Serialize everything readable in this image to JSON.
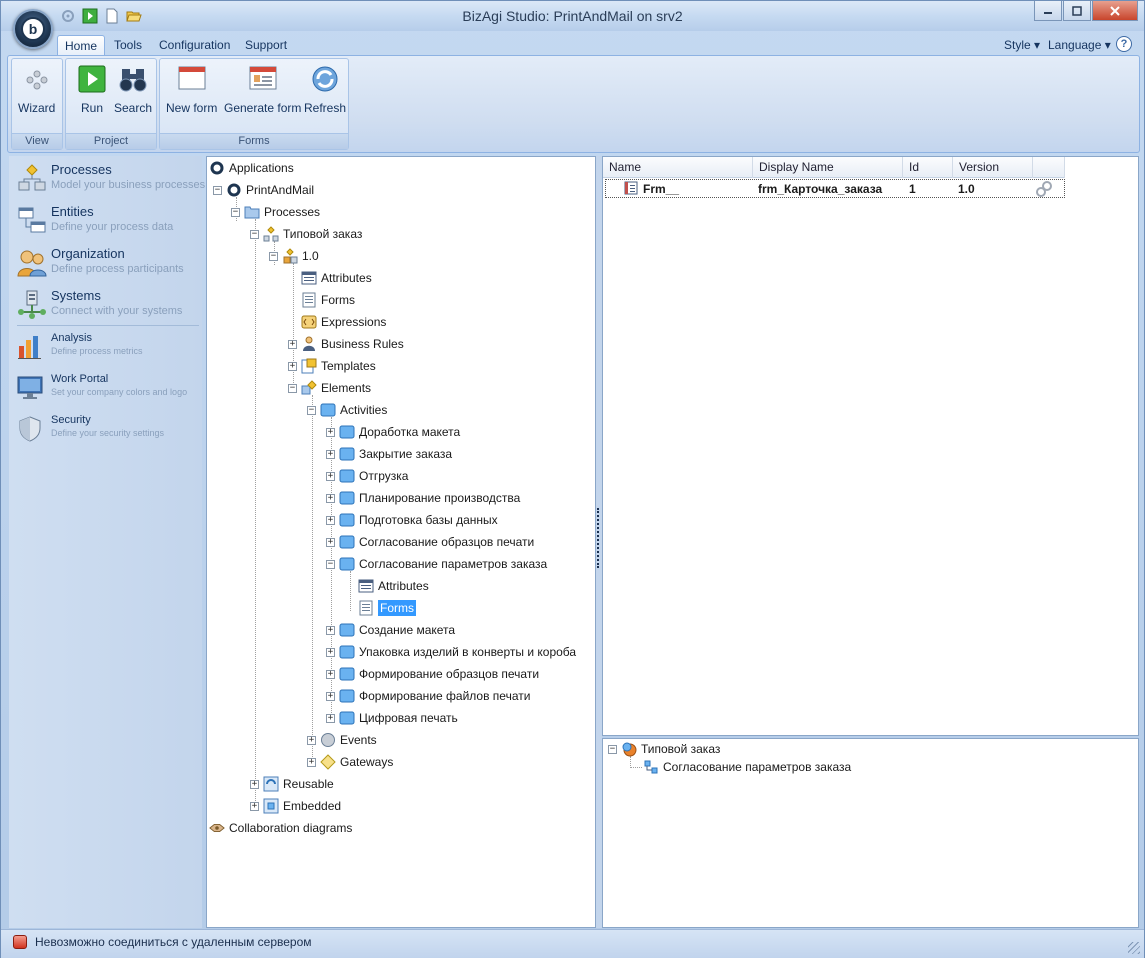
{
  "window": {
    "title": "BizAgi Studio: PrintAndMail on srv2",
    "controls": [
      "minimize-icon",
      "maximize-icon",
      "close-icon"
    ]
  },
  "quick_access": [
    "settings-icon",
    "run-icon",
    "new-icon",
    "open-icon"
  ],
  "ribbon": {
    "tabs": [
      "Home",
      "Tools",
      "Configuration",
      "Support"
    ],
    "active_tab": "Home",
    "right_menus": [
      "Style",
      "Language"
    ],
    "groups": [
      {
        "label": "View",
        "buttons": [
          {
            "label": "Wizard",
            "icon": "wizard-icon"
          }
        ]
      },
      {
        "label": "Project",
        "buttons": [
          {
            "label": "Run",
            "icon": "run-icon"
          },
          {
            "label": "Search",
            "icon": "binoculars-icon"
          }
        ]
      },
      {
        "label": "Forms",
        "buttons": [
          {
            "label": "New form",
            "icon": "new-form-icon"
          },
          {
            "label": "Generate form",
            "icon": "generate-form-icon"
          },
          {
            "label": "Refresh",
            "icon": "refresh-icon"
          }
        ]
      }
    ]
  },
  "leftnav": {
    "items": [
      {
        "title": "Processes",
        "subtitle": "Model your business processes",
        "icon": "processes-icon"
      },
      {
        "title": "Entities",
        "subtitle": "Define your process data",
        "icon": "entities-icon"
      },
      {
        "title": "Organization",
        "subtitle": "Define process participants",
        "icon": "organization-icon"
      },
      {
        "title": "Systems",
        "subtitle": "Connect with your systems",
        "icon": "systems-icon"
      },
      {
        "title": "Analysis",
        "subtitle": "Define process metrics",
        "icon": "analysis-icon"
      },
      {
        "title": "Work Portal",
        "subtitle": "Set your company colors and logo",
        "icon": "monitor-icon"
      },
      {
        "title": "Security",
        "subtitle": "Define your security settings",
        "icon": "shield-icon"
      }
    ]
  },
  "tree": {
    "nodes": [
      {
        "label": "Applications",
        "icon": "bizagi-icon",
        "exp": ""
      },
      {
        "label": "PrintAndMail",
        "icon": "bizagi-icon",
        "exp": "−"
      },
      {
        "label": "Processes",
        "icon": "folder-icon",
        "exp": "−"
      },
      {
        "label": "Типовой заказ",
        "icon": "process-icon",
        "exp": "−"
      },
      {
        "label": "1.0",
        "icon": "version-icon",
        "exp": "−"
      },
      {
        "label": "Attributes",
        "icon": "attributes-icon",
        "exp": ""
      },
      {
        "label": "Forms",
        "icon": "form-icon",
        "exp": ""
      },
      {
        "label": "Expressions",
        "icon": "expression-icon",
        "exp": ""
      },
      {
        "label": "Business Rules",
        "icon": "business-rules-icon",
        "exp": "+"
      },
      {
        "label": "Templates",
        "icon": "templates-icon",
        "exp": "+"
      },
      {
        "label": "Elements",
        "icon": "elements-icon",
        "exp": "−"
      },
      {
        "label": "Activities",
        "icon": "activity-icon",
        "exp": "−"
      },
      {
        "label": "Доработка макета",
        "icon": "activity-icon",
        "exp": "+"
      },
      {
        "label": "Закрытие заказа",
        "icon": "activity-icon",
        "exp": "+"
      },
      {
        "label": "Отгрузка",
        "icon": "activity-icon",
        "exp": "+"
      },
      {
        "label": "Планирование производства",
        "icon": "activity-icon",
        "exp": "+"
      },
      {
        "label": "Подготовка базы данных",
        "icon": "activity-icon",
        "exp": "+"
      },
      {
        "label": "Согласование образцов печати",
        "icon": "activity-icon",
        "exp": "+"
      },
      {
        "label": "Согласование параметров заказа",
        "icon": "activity-icon",
        "exp": "−"
      },
      {
        "label": "Attributes",
        "icon": "attributes-icon",
        "exp": ""
      },
      {
        "label": "Forms",
        "icon": "form-icon",
        "exp": "",
        "selected": true
      },
      {
        "label": "Создание макета",
        "icon": "activity-icon",
        "exp": "+"
      },
      {
        "label": "Упаковка изделий в конверты  и короба",
        "icon": "activity-icon",
        "exp": "+"
      },
      {
        "label": "Формирование образцов печати",
        "icon": "activity-icon",
        "exp": "+"
      },
      {
        "label": "Формирование файлов печати",
        "icon": "activity-icon",
        "exp": "+"
      },
      {
        "label": "Цифровая печать",
        "icon": "activity-icon",
        "exp": "+"
      },
      {
        "label": "Events",
        "icon": "event-icon",
        "exp": "+"
      },
      {
        "label": "Gateways",
        "icon": "gateway-icon",
        "exp": "+"
      },
      {
        "label": "Reusable",
        "icon": "reusable-icon",
        "exp": "+"
      },
      {
        "label": "Embedded",
        "icon": "embedded-icon",
        "exp": "+"
      },
      {
        "label": "Collaboration diagrams",
        "icon": "collaboration-icon",
        "exp": ""
      }
    ]
  },
  "grid": {
    "columns": [
      "Name",
      "Display Name",
      "Id",
      "Version"
    ],
    "rows": [
      {
        "name": "Frm__",
        "display_name": "frm_Карточка_заказа",
        "id": "1",
        "version": "1.0",
        "row_icon": "form-icon",
        "action_icon": "link-icon"
      }
    ]
  },
  "usage_tree": {
    "root": "Типовой заказ",
    "child": "Согласование параметров заказа"
  },
  "status": {
    "text": "Невозможно соединиться с удаленным сервером",
    "icon": "error-icon"
  },
  "colors": {
    "accent": "#3399ff",
    "frame": "#bcd3ec",
    "status_error": "#d0331f"
  }
}
